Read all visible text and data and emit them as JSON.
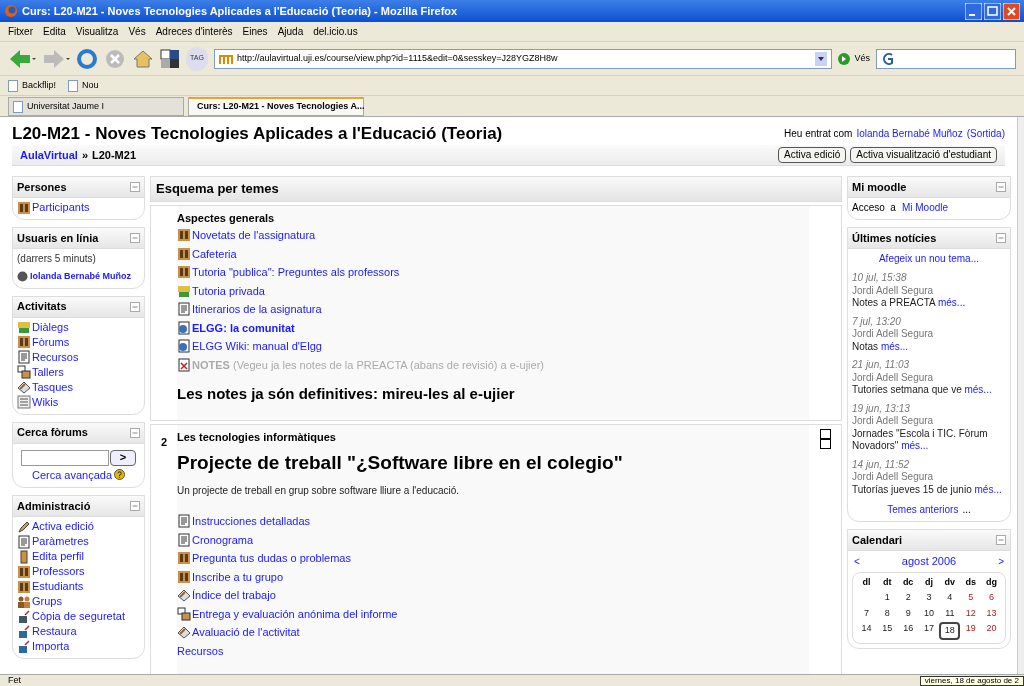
{
  "window": {
    "title": "Curs: L20-M21 - Noves Tecnologies Aplicades a l'Educació (Teoria) - Mozilla Firefox"
  },
  "menu": [
    "Fitxer",
    "Edita",
    "Visualitza",
    "Vés",
    "Adreces d'interès",
    "Eines",
    "Ajuda",
    "del.icio.us"
  ],
  "toolbar": {
    "tag_label": "TAG",
    "url": "http://aulavirtual.uji.es/course/view.php?id=1115&edit=0&sesskey=J28YGZ8H8w",
    "go": "Vés"
  },
  "bookmarks": [
    "Backflip!",
    "Nou"
  ],
  "tabs": [
    {
      "label": "Universitat Jaume I",
      "selected": false
    },
    {
      "label": "Curs: L20-M21 - Noves Tecnologies A...",
      "selected": true
    }
  ],
  "page": {
    "title": "L20-M21 - Noves Tecnologies Aplicades a l'Educació (Teoria)",
    "login": {
      "prefix": "Heu entrat com",
      "user": "Iolanda Bernabé Muñoz",
      "logout": "(Sortida)"
    },
    "breadcrumb": {
      "items": [
        "AulaVirtual",
        "L20-M21"
      ],
      "separator": "»"
    },
    "buttons": [
      "Activa edició",
      "Activa visualització d'estudiant"
    ]
  },
  "left": [
    {
      "kind": "links",
      "title": "Persones",
      "items": [
        {
          "kind": "forum",
          "label": "Participants"
        }
      ]
    },
    {
      "kind": "users",
      "title": "Usuaris en línia",
      "note": "(darrers 5 minuts)",
      "users": [
        "Iolanda Bernabé Muñoz"
      ]
    },
    {
      "kind": "links",
      "title": "Activitats",
      "items": [
        {
          "kind": "chat",
          "label": "Diàlegs"
        },
        {
          "kind": "forum",
          "label": "Fòrums"
        },
        {
          "kind": "page",
          "label": "Recursos"
        },
        {
          "kind": "workshop",
          "label": "Tallers"
        },
        {
          "kind": "assignment",
          "label": "Tasques"
        },
        {
          "kind": "wiki",
          "label": "Wikis"
        }
      ]
    },
    {
      "kind": "search",
      "title": "Cerca fòrums",
      "button": ">",
      "link": "Cerca avançada"
    },
    {
      "kind": "links",
      "title": "Administració",
      "items": [
        {
          "kind": "edit",
          "label": "Activa edició"
        },
        {
          "kind": "page",
          "label": "Paràmetres"
        },
        {
          "kind": "person",
          "label": "Edita perfil"
        },
        {
          "kind": "forum",
          "label": "Professors"
        },
        {
          "kind": "forum",
          "label": "Estudiants"
        },
        {
          "kind": "group",
          "label": "Grups"
        },
        {
          "kind": "backup",
          "label": "Còpia de seguretat"
        },
        {
          "kind": "restore",
          "label": "Restaura"
        },
        {
          "kind": "restore",
          "label": "Importa"
        }
      ]
    }
  ],
  "center": {
    "title": "Esquema per temes",
    "sections": [
      {
        "title": "Aspectes generals",
        "items": [
          {
            "kind": "forum",
            "text": "Novetats de l'assignatura",
            "dimmed": false
          },
          {
            "kind": "forum",
            "text": "Cafeteria",
            "dimmed": false
          },
          {
            "kind": "forum",
            "text": "Tutoria \"publica\": Preguntes als professors",
            "dimmed": false
          },
          {
            "kind": "chat",
            "text": "Tutoria privada",
            "dimmed": false
          },
          {
            "kind": "page",
            "text": "Itinerarios de la asignatura",
            "dimmed": false
          },
          {
            "kind": "web",
            "text": "**ELGG: la comunitat**",
            "dimmed": false
          },
          {
            "kind": "web",
            "text": "ELGG Wiki: manual d'Elgg",
            "dimmed": false
          },
          {
            "kind": "pdf",
            "text": "**NOTES** (Vegeu ja les notes de la PREACTA (abans de revisió) a e-ujier)",
            "dimmed": true
          }
        ],
        "heading_after": "Les notes ja són definitives: mireu-les al e-ujier"
      },
      {
        "number": "2",
        "title": "Les tecnologies informàtiques",
        "heading": "Projecte de treball \"¿Software libre en el colegio\"",
        "description": "Un projecte de treball en grup sobre software lliure a l'educació.",
        "items": [
          {
            "kind": "page",
            "text": "Instrucciones detalladas",
            "dimmed": false
          },
          {
            "kind": "page",
            "text": "Cronograma",
            "dimmed": false
          },
          {
            "kind": "forum",
            "text": "Pregunta tus dudas o problemas",
            "dimmed": false
          },
          {
            "kind": "forum",
            "text": "Inscribe a tu grupo",
            "dimmed": false
          },
          {
            "kind": "assignment",
            "text": "Índice del trabajo",
            "dimmed": false
          },
          {
            "kind": "workshop",
            "text": "Entrega y evaluación anónima del informe",
            "dimmed": false
          },
          {
            "kind": "assignment",
            "text": "Avaluació de l'activitat",
            "dimmed": false
          },
          {
            "kind": "label",
            "text": "Recursos",
            "dimmed": false
          }
        ]
      }
    ]
  },
  "right": {
    "moodle": {
      "title": "Mi moodle",
      "prefix": "Acceso  a",
      "link": "Mi Moodle"
    },
    "news": {
      "title": "Últimes notícies",
      "add": "Afegeix un nou tema...",
      "items": [
        {
          "date": "10 jul, 15:38",
          "author": "Jordi Adell Segura",
          "text": "Notes a PREACTA",
          "more": "més..."
        },
        {
          "date": "7 jul, 13:20",
          "author": "Jordi Adell Segura",
          "text": "Notas",
          "more": "més..."
        },
        {
          "date": "21 jun, 11:03",
          "author": "Jordi Adell Segura",
          "text": "Tutories setmana que ve",
          "more": "més..."
        },
        {
          "date": "19 jun, 13:13",
          "author": "Jordi Adell Segura",
          "text": "Jornades \"Escola i TIC. Fòrum Novadors\"",
          "more": "més..."
        },
        {
          "date": "14 jun, 11:52",
          "author": "Jordi Adell Segura",
          "text": "Tutorías jueves 15 de junio",
          "more": "més..."
        }
      ],
      "older": "Temes anteriors",
      "older_suffix": "..."
    },
    "calendar": {
      "title": "Calendari",
      "prev": "<",
      "month": "agost 2006",
      "next": ">",
      "weekdays": [
        "dl",
        "dt",
        "dc",
        "dj",
        "dv",
        "ds",
        "dg"
      ],
      "weeks": [
        {
          "days": [
            {
              "n": "1",
              "today": false
            },
            {
              "n": "2",
              "today": false
            },
            {
              "n": "3",
              "today": false
            },
            {
              "n": "4",
              "today": false
            },
            {
              "n": "5",
              "today": false
            },
            {
              "n": "6",
              "today": false
            }
          ]
        },
        {
          "days": [
            {
              "n": "7",
              "today": false
            },
            {
              "n": "8",
              "today": false
            },
            {
              "n": "9",
              "today": false
            },
            {
              "n": "10",
              "today": false
            },
            {
              "n": "11",
              "today": false
            },
            {
              "n": "12",
              "today": false
            },
            {
              "n": "13",
              "today": false
            }
          ]
        },
        {
          "days": [
            {
              "n": "14",
              "today": false
            },
            {
              "n": "15",
              "today": false
            },
            {
              "n": "16",
              "today": false
            },
            {
              "n": "17",
              "today": false
            },
            {
              "n": "18",
              "today": true
            },
            {
              "n": "19",
              "today": false
            },
            {
              "n": "20",
              "today": false
            }
          ]
        }
      ]
    }
  },
  "status_bar": {
    "text": "Fet",
    "tooltip": "viernes, 18 de agosto de 2"
  }
}
